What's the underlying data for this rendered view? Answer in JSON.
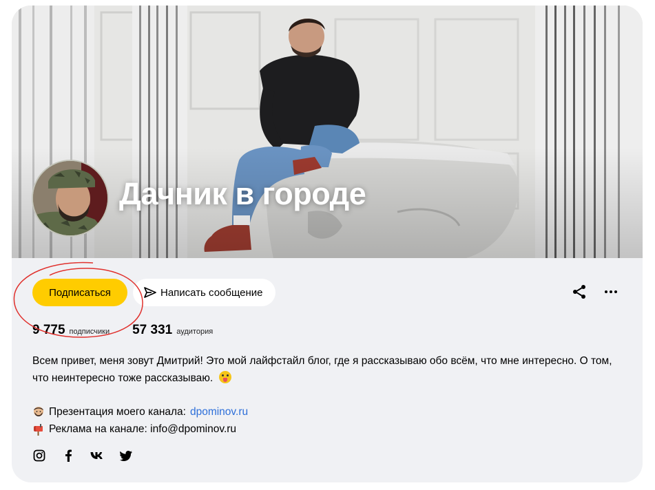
{
  "channel": {
    "title": "Дачник в городе"
  },
  "actions": {
    "subscribe_label": "Подписаться",
    "message_label": "Написать сообщение"
  },
  "stats": {
    "subscribers_value": "9 775",
    "subscribers_label": "подписчики",
    "audience_value": "57 331",
    "audience_label": "аудитория"
  },
  "description": {
    "text": "Всем привет, меня зовут Дмитрий! Это мой лайфстайл блог, где я рассказываю обо всём, что мне интересно. О том, что неинтересно тоже рассказываю."
  },
  "links": {
    "presentation_label": "Презентация моего канала:",
    "presentation_link": "dpominov.ru",
    "ads_label": "Реклама на канале: info@dpominov.ru"
  },
  "icons": {
    "share": "share-icon",
    "more": "more-icon",
    "send": "send-icon",
    "instagram": "instagram-icon",
    "facebook": "facebook-icon",
    "vk": "vk-icon",
    "twitter": "twitter-icon"
  },
  "colors": {
    "subscribe_button": "#ffcc00",
    "card_background": "#f0f1f4",
    "link": "#2d6fd9",
    "annotation_circle": "#e0302c"
  }
}
